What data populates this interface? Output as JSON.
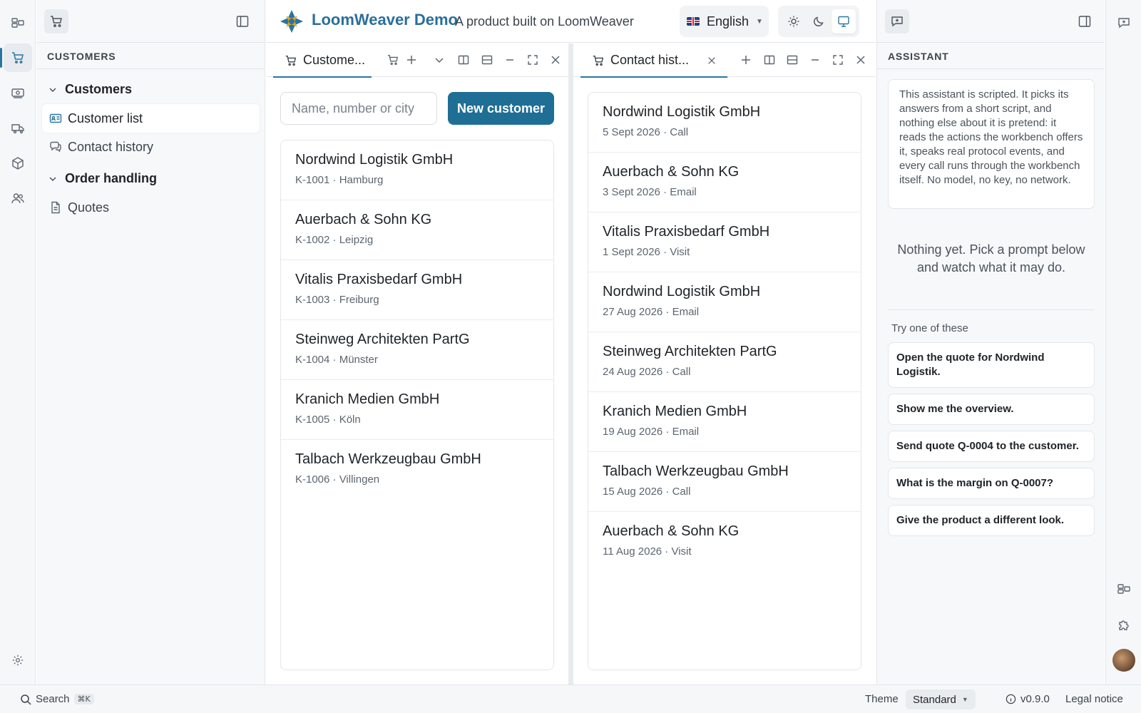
{
  "header": {
    "title": "LoomWeaver Demo",
    "subtitle": "A product built on LoomWeaver",
    "language": "English"
  },
  "sidebar": {
    "heading": "CUSTOMERS",
    "groups": [
      {
        "label": "Customers",
        "items": [
          {
            "label": "Customer list",
            "icon": "contact-card-icon"
          },
          {
            "label": "Contact history",
            "icon": "chat-icon"
          }
        ]
      },
      {
        "label": "Order handling",
        "items": [
          {
            "label": "Quotes",
            "icon": "document-icon"
          }
        ]
      }
    ]
  },
  "customers_tab": {
    "label": "Custome...",
    "search_placeholder": "Name, number or city",
    "new_button": "New customer",
    "rows": [
      {
        "name": "Nordwind Logistik GmbH",
        "meta": "K-1001 · Hamburg"
      },
      {
        "name": "Auerbach & Sohn KG",
        "meta": "K-1002 · Leipzig"
      },
      {
        "name": "Vitalis Praxisbedarf GmbH",
        "meta": "K-1003 · Freiburg"
      },
      {
        "name": "Steinweg Architekten PartG",
        "meta": "K-1004 · Münster"
      },
      {
        "name": "Kranich Medien GmbH",
        "meta": "K-1005 · Köln"
      },
      {
        "name": "Talbach Werkzeugbau GmbH",
        "meta": "K-1006 · Villingen"
      }
    ]
  },
  "history_tab": {
    "label": "Contact hist...",
    "rows": [
      {
        "name": "Nordwind Logistik GmbH",
        "meta": "5 Sept 2026 · Call"
      },
      {
        "name": "Auerbach & Sohn KG",
        "meta": "3 Sept 2026 · Email"
      },
      {
        "name": "Vitalis Praxisbedarf GmbH",
        "meta": "1 Sept 2026 · Visit"
      },
      {
        "name": "Nordwind Logistik GmbH",
        "meta": "27 Aug 2026 · Email"
      },
      {
        "name": "Steinweg Architekten PartG",
        "meta": "24 Aug 2026 · Call"
      },
      {
        "name": "Kranich Medien GmbH",
        "meta": "19 Aug 2026 · Email"
      },
      {
        "name": "Talbach Werkzeugbau GmbH",
        "meta": "15 Aug 2026 · Call"
      },
      {
        "name": "Auerbach & Sohn KG",
        "meta": "11 Aug 2026 · Visit"
      }
    ]
  },
  "assistant": {
    "heading": "ASSISTANT",
    "note": "This assistant is scripted. It picks its answers from a short script, and nothing else about it is pretend: it reads the actions the workbench offers it, speaks real protocol events, and every call runs through the workbench itself. No model, no key, no network.",
    "empty": "Nothing yet. Pick a prompt below and watch what it may do.",
    "try_label": "Try one of these",
    "prompts": [
      "Open the quote for Nordwind Logistik.",
      "Show me the overview.",
      "Send quote Q-0004 to the customer.",
      "What is the margin on Q-0007?",
      "Give the product a different look."
    ]
  },
  "statusbar": {
    "search_label": "Search",
    "shortcut": "⌘K",
    "theme_label": "Theme",
    "theme_value": "Standard",
    "version": "v0.9.0",
    "legal": "Legal notice"
  },
  "colors": {
    "accent": "#2a75a0",
    "brand": "#2a6f9a",
    "primary_button": "#1f6e96"
  }
}
